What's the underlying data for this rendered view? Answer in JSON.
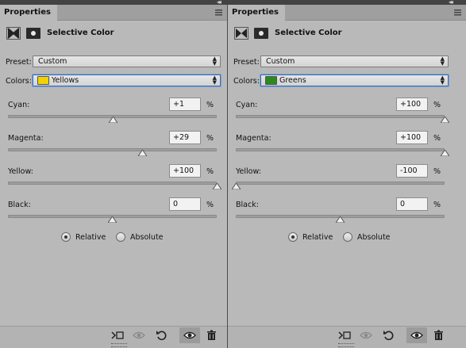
{
  "panels": [
    {
      "tab_label": "Properties",
      "title": "Selective Color",
      "preset_label": "Preset:",
      "preset_value": "Custom",
      "colors_label": "Colors:",
      "colors_value": "Yellows",
      "swatch_color": "#f2d200",
      "sliders": [
        {
          "label": "Cyan:",
          "value": "+1",
          "unit": "%",
          "level_fraction": 0.505
        },
        {
          "label": "Magenta:",
          "value": "+29",
          "unit": "%",
          "level_fraction": 0.645
        },
        {
          "label": "Yellow:",
          "value": "+100",
          "unit": "%",
          "level_fraction": 1.0
        },
        {
          "label": "Black:",
          "value": "0",
          "unit": "%",
          "level_fraction": 0.5
        }
      ],
      "method_options": [
        {
          "label": "Relative",
          "selected": true
        },
        {
          "label": "Absolute",
          "selected": false
        }
      ]
    },
    {
      "tab_label": "Properties",
      "title": "Selective Color",
      "preset_label": "Preset:",
      "preset_value": "Custom",
      "colors_label": "Colors:",
      "colors_value": "Greens",
      "swatch_color": "#2a8a1c",
      "sliders": [
        {
          "label": "Cyan:",
          "value": "+100",
          "unit": "%",
          "level_fraction": 1.0
        },
        {
          "label": "Magenta:",
          "value": "+100",
          "unit": "%",
          "level_fraction": 1.0
        },
        {
          "label": "Yellow:",
          "value": "-100",
          "unit": "%",
          "level_fraction": 0.0
        },
        {
          "label": "Black:",
          "value": "0",
          "unit": "%",
          "level_fraction": 0.5
        }
      ],
      "method_options": [
        {
          "label": "Relative",
          "selected": true
        },
        {
          "label": "Absolute",
          "selected": false
        }
      ]
    }
  ],
  "footer_icons": [
    "clip-to-layer-icon",
    "toggle-visibility-history-icon",
    "reset-icon",
    "visibility-eye-icon",
    "trash-icon"
  ],
  "colors": {
    "panel_bg": "#b9b9b9",
    "focus_blue": "#3c6fb3"
  }
}
